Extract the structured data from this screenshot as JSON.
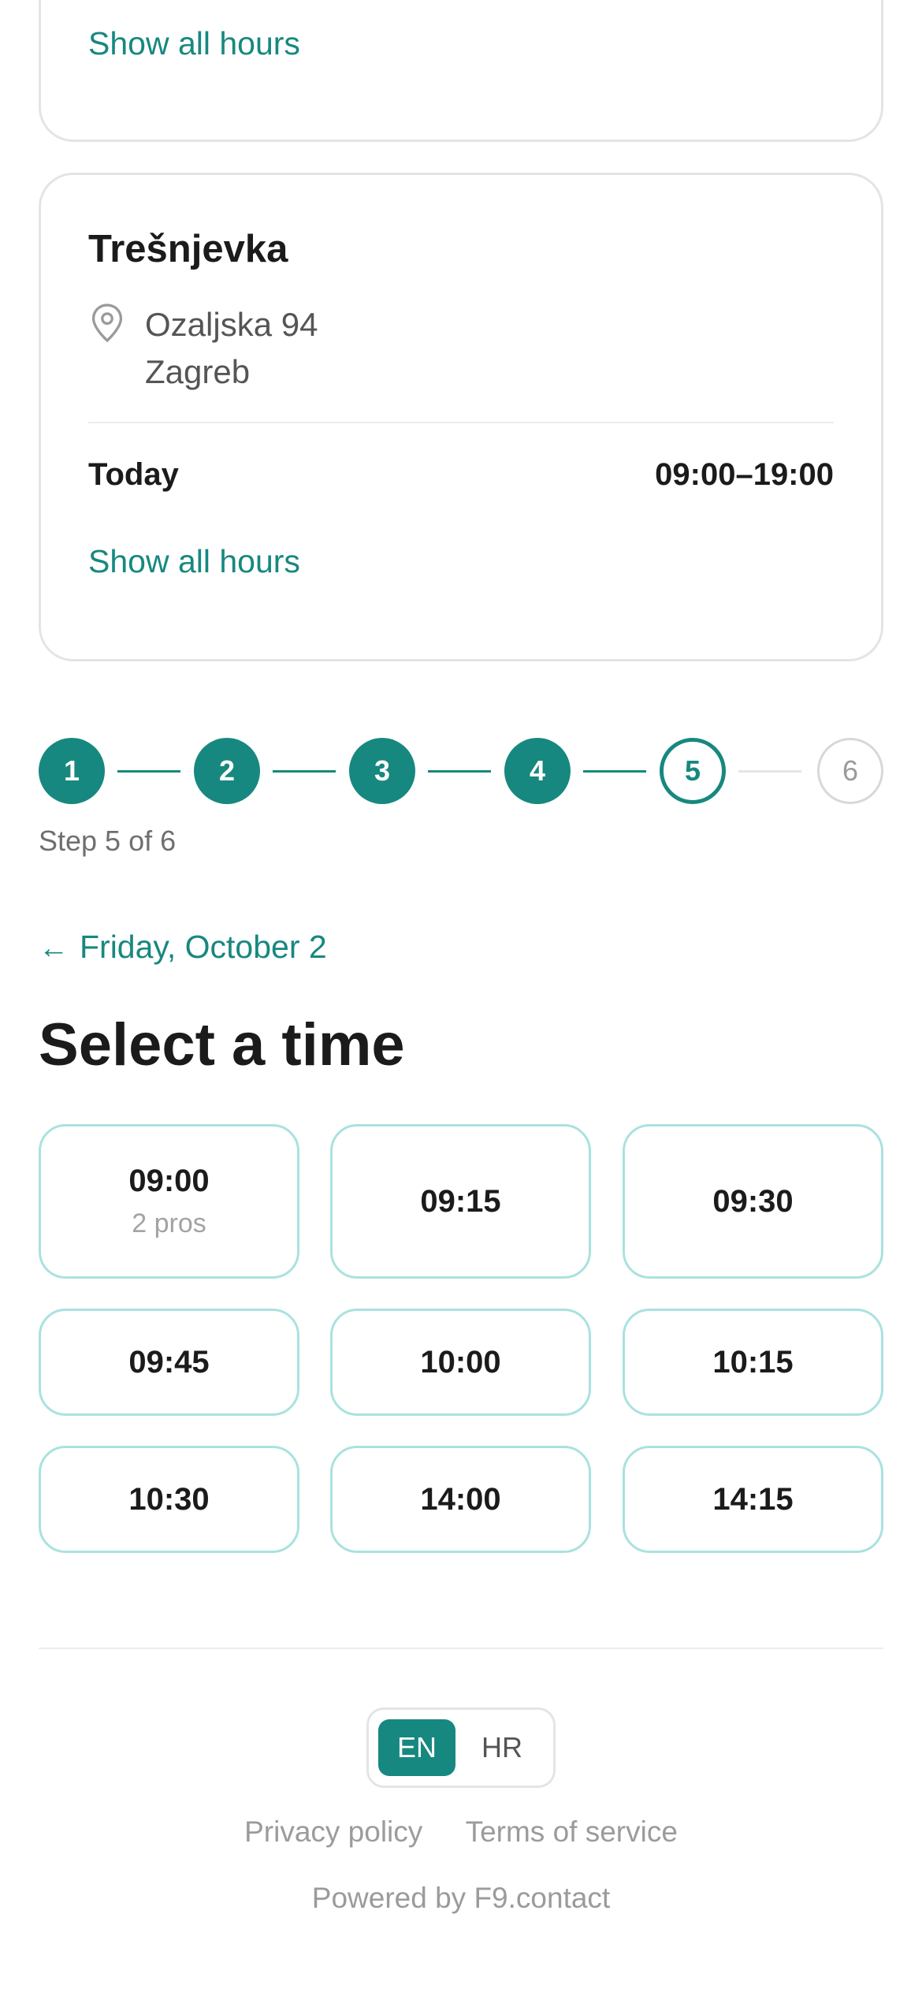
{
  "top_card": {
    "show_hours_label": "Show all hours"
  },
  "location": {
    "name": "Trešnjevka",
    "address_line1": "Ozaljska 94",
    "address_line2": "Zagreb",
    "today_label": "Today",
    "today_hours": "09:00–19:00",
    "show_hours_label": "Show all hours",
    "icon": "map-pin-icon"
  },
  "stepper": {
    "steps": [
      "1",
      "2",
      "3",
      "4",
      "5",
      "6"
    ],
    "current": 5,
    "text": "Step 5 of 6",
    "accent_color": "#17887f"
  },
  "date_nav": {
    "arrow": "←",
    "label": "Friday, October 2"
  },
  "section_title": "Select a time",
  "slots": [
    {
      "time": "09:00",
      "sub": "2 pros"
    },
    {
      "time": "09:15",
      "sub": ""
    },
    {
      "time": "09:30",
      "sub": ""
    },
    {
      "time": "09:45",
      "sub": ""
    },
    {
      "time": "10:00",
      "sub": ""
    },
    {
      "time": "10:15",
      "sub": ""
    },
    {
      "time": "10:30",
      "sub": ""
    },
    {
      "time": "14:00",
      "sub": ""
    },
    {
      "time": "14:15",
      "sub": ""
    }
  ],
  "language": {
    "options": [
      "EN",
      "HR"
    ],
    "selected": "EN"
  },
  "footer": {
    "privacy": "Privacy policy",
    "terms": "Terms of service",
    "powered": "Powered by F9.contact"
  }
}
